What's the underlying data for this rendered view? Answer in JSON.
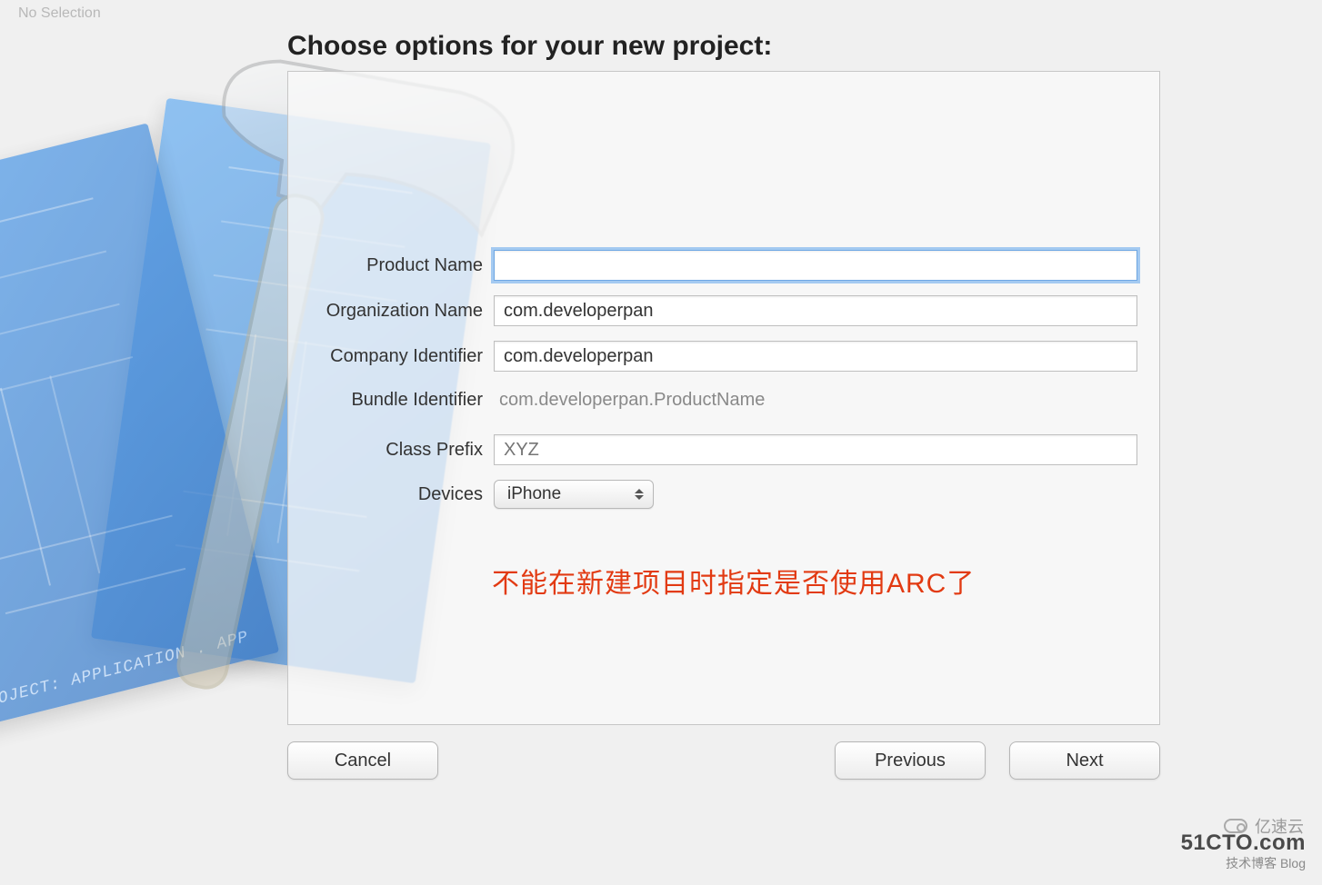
{
  "window": {
    "label": "No Selection"
  },
  "title": "Choose options for your new project:",
  "form": {
    "product_name": {
      "label": "Product Name",
      "value": ""
    },
    "organization_name": {
      "label": "Organization Name",
      "value": "com.developerpan"
    },
    "company_identifier": {
      "label": "Company Identifier",
      "value": "com.developerpan"
    },
    "bundle_identifier": {
      "label": "Bundle Identifier",
      "value": "com.developerpan.ProductName"
    },
    "class_prefix": {
      "label": "Class Prefix",
      "placeholder": "XYZ",
      "value": ""
    },
    "devices": {
      "label": "Devices",
      "selected": "iPhone"
    }
  },
  "annotation": "不能在新建项目时指定是否使用ARC了",
  "buttons": {
    "cancel": "Cancel",
    "previous": "Previous",
    "next": "Next"
  },
  "background": {
    "blueprint_caption": "PROJECT: APPLICATION . APP"
  },
  "watermarks": {
    "cto": "51CTO.com",
    "cto_sub": "技术博客  Blog",
    "yisu": "亿速云"
  }
}
